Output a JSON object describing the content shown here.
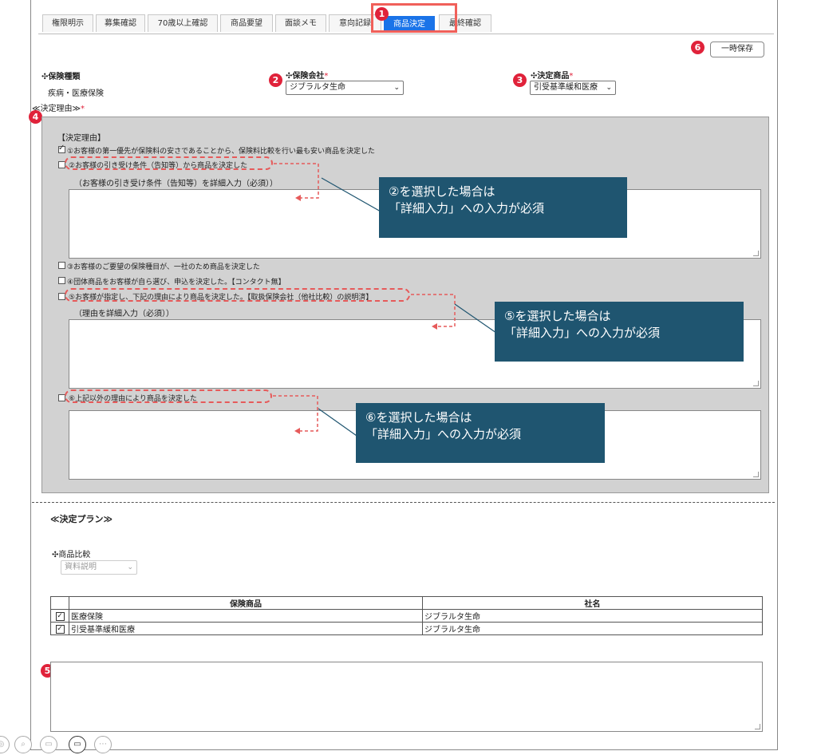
{
  "tabs": [
    "権限明示",
    "募集確認",
    "70歳以上確認",
    "商品要望",
    "面談メモ",
    "意向記録",
    "商品決定",
    "最終確認"
  ],
  "save_button": "一時保存",
  "markers": {
    "m1": "1",
    "m2": "2",
    "m3": "3",
    "m4": "4",
    "m5": "5",
    "m6": "6"
  },
  "insurance_type": {
    "label": "保険種類",
    "value": "疾病・医療保険"
  },
  "insurance_company": {
    "label": "保険会社",
    "required": "*",
    "value": "ジブラルタ生命"
  },
  "decision_product": {
    "label": "決定商品",
    "required": "*",
    "value": "引受基準緩和医療"
  },
  "decision_reason_label": "≪決定理由≫",
  "decision_reason_required": "*",
  "reasons": {
    "header": "【決定理由】",
    "r1": "①お客様の第一優先が保険料の安さであることから、保険料比較を行い最も安い商品を決定した",
    "r2": "②お客様の引き受け条件（告知等）から商品を決定した",
    "r2_detail": "（お客様の引き受け条件（告知等）を詳細入力（必須））",
    "r3": "③お客様のご要望の保険種目が、一社のため商品を決定した",
    "r4": "④団体商品をお客様が自ら選び、申込を決定した。【コンタクト無】",
    "r5": "⑤お客様が指定し、下記の理由により商品を決定した。【取扱保険会社（他社比較）の説明済】",
    "r5_detail": "（理由を詳細入力（必須））",
    "r6": "⑥上記以外の理由により商品を決定した"
  },
  "callouts": {
    "c2_line1": "②を選択した場合は",
    "c2_line2": "「詳細入力」への入力が必須",
    "c5_line1": "⑤を選択した場合は",
    "c5_line2": "「詳細入力」への入力が必須",
    "c6_line1": "⑥を選択した場合は",
    "c6_line2": "「詳細入力」への入力が必須"
  },
  "plan_label": "≪決定プラン≫",
  "product_compare": {
    "label": "商品比較",
    "value": "資料説明"
  },
  "table": {
    "headers": [
      "保険商品",
      "社名"
    ],
    "rows": [
      {
        "product": "医療保険",
        "company": "ジブラルタ生命"
      },
      {
        "product": "引受基準緩和医療",
        "company": "ジブラルタ生命"
      }
    ]
  },
  "colors": {
    "accent": "#1a73e8",
    "marker": "#e0223a",
    "callout": "#1f5570",
    "dashed": "#e65a5a"
  }
}
